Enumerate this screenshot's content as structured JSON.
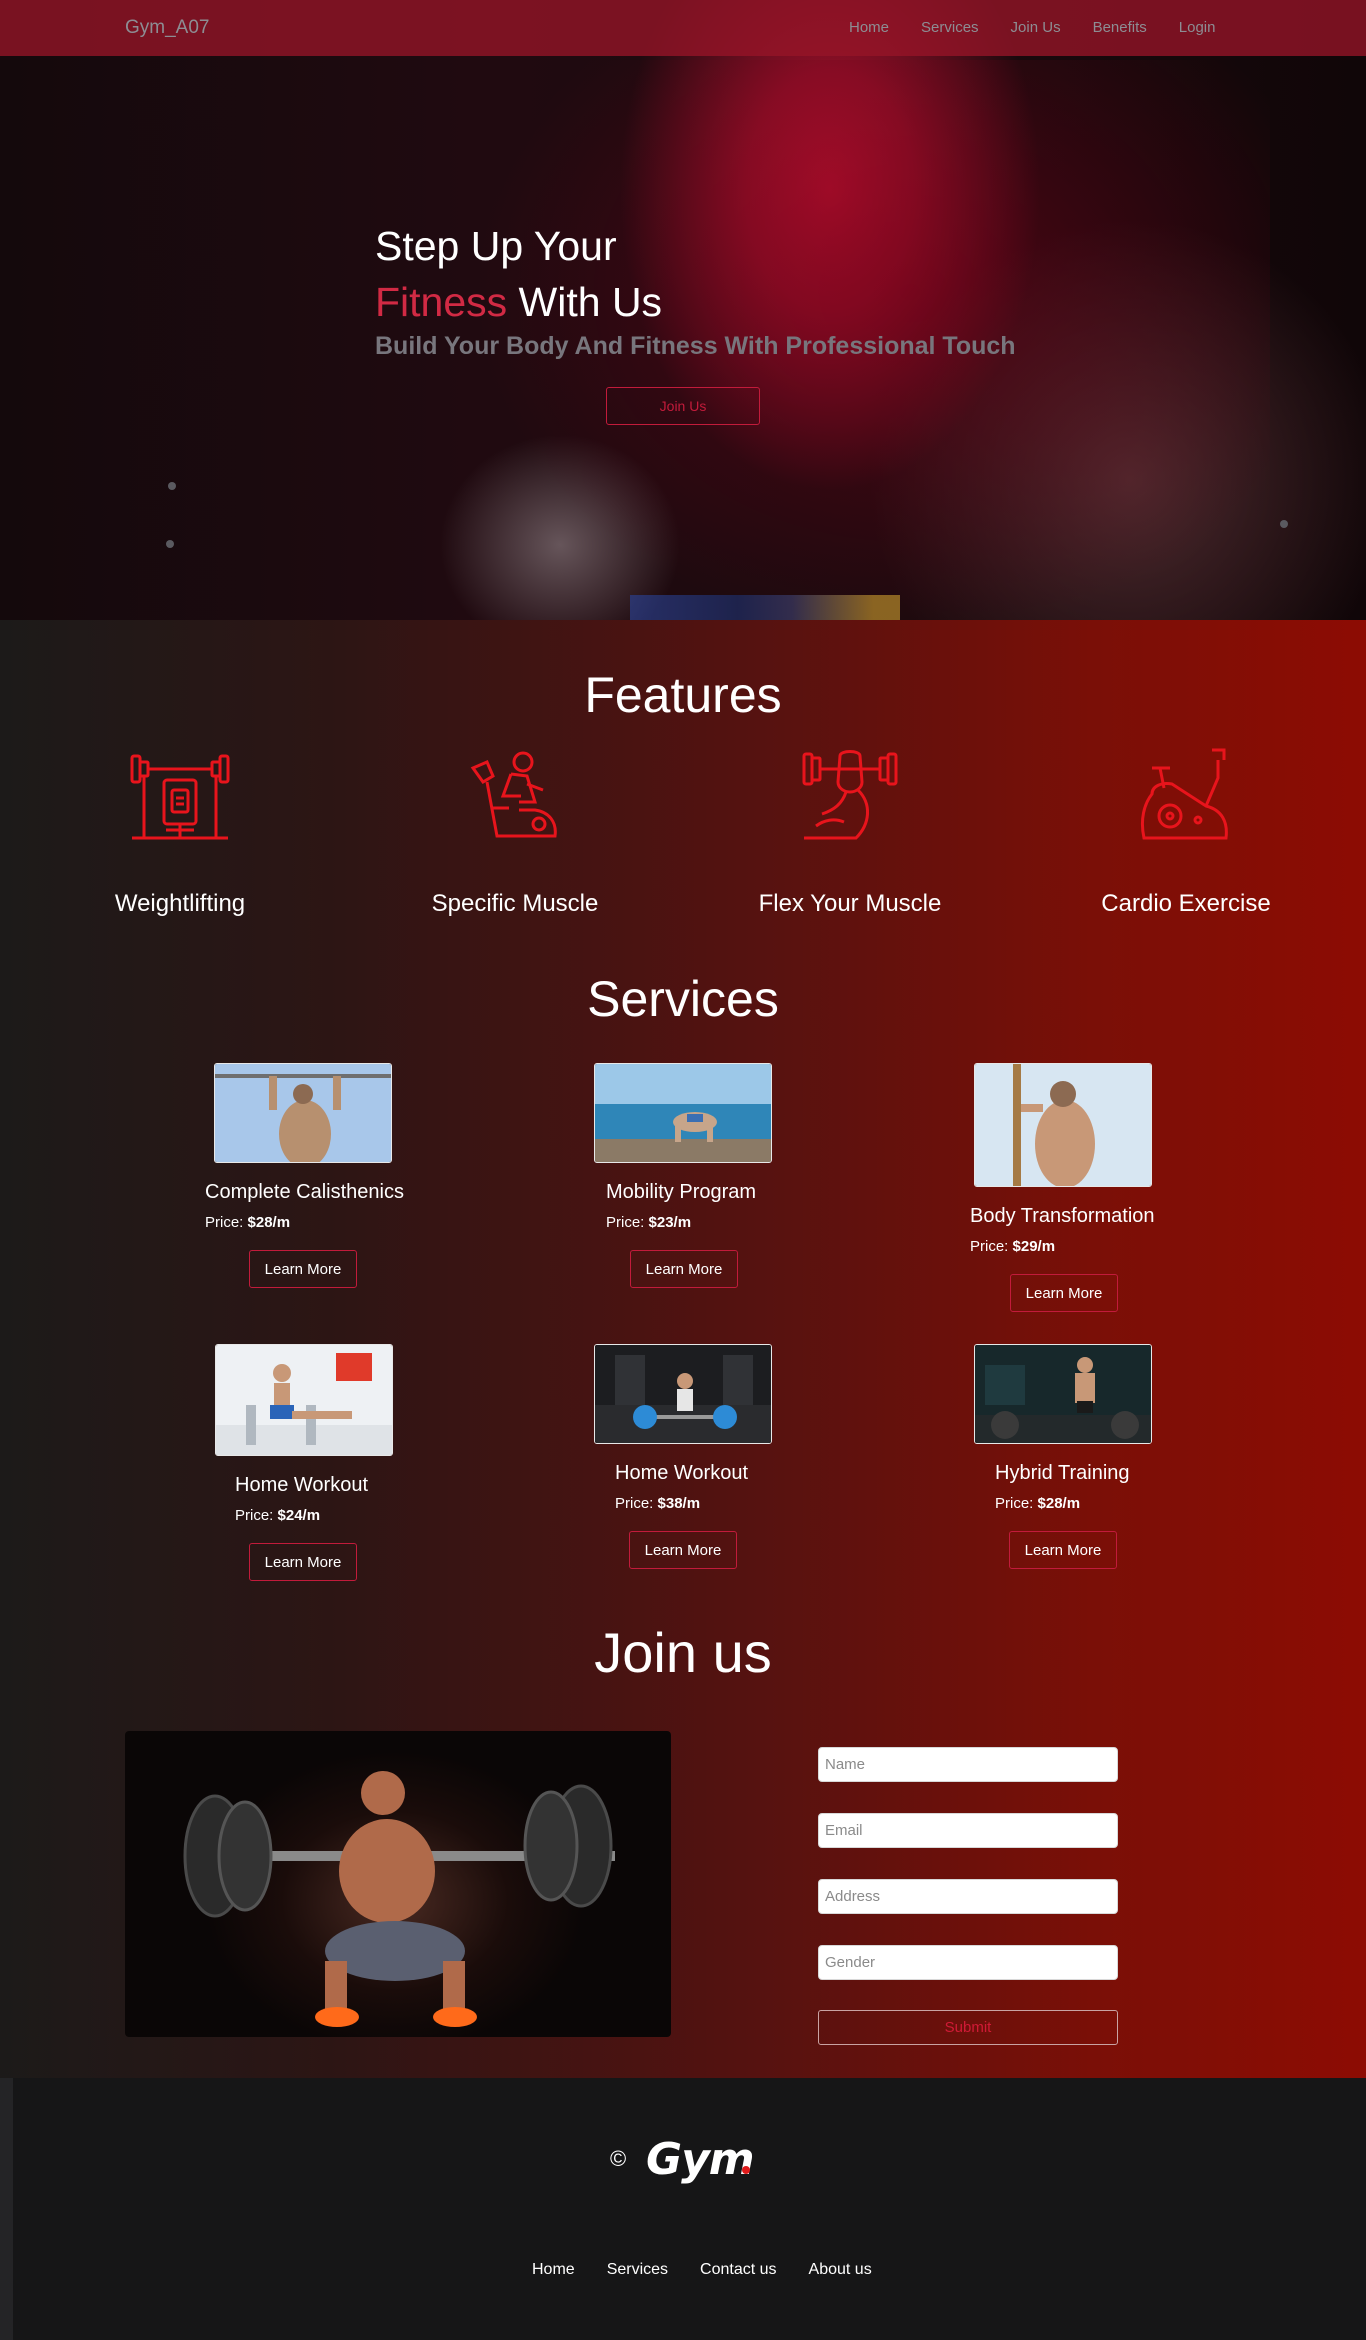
{
  "nav": {
    "brand": "Gym_A07",
    "links": [
      "Home",
      "Services",
      "Join Us",
      "Benefits",
      "Login"
    ]
  },
  "hero": {
    "line1": "Step Up Your",
    "line2_accent": "Fitness",
    "line2_rest": " With Us",
    "subtitle": "Build Your Body And Fitness With Professional Touch",
    "button": "Join Us"
  },
  "features": {
    "title": "Features",
    "items": [
      {
        "label": "Weightlifting",
        "icon": "weight-bench-icon"
      },
      {
        "label": "Specific Muscle",
        "icon": "exercise-bike-rider-icon"
      },
      {
        "label": "Flex Your Muscle",
        "icon": "flexing-arm-icon"
      },
      {
        "label": "Cardio Exercise",
        "icon": "stationary-bike-icon"
      }
    ]
  },
  "services": {
    "title": "Services",
    "price_prefix": "Price:",
    "button": "Learn More",
    "items": [
      {
        "name": "Complete Calisthenics",
        "price": "$28/m"
      },
      {
        "name": "Mobility Program",
        "price": "$23/m"
      },
      {
        "name": "Body Transformation",
        "price": "$29/m"
      },
      {
        "name": "Home Workout",
        "price": "$24/m"
      },
      {
        "name": "Home Workout",
        "price": "$38/m"
      },
      {
        "name": "Hybrid Training",
        "price": "$28/m"
      }
    ]
  },
  "join": {
    "title": "Join us",
    "fields": {
      "name": "Name",
      "email": "Email",
      "address": "Address",
      "gender": "Gender"
    },
    "submit": "Submit"
  },
  "footer": {
    "copyright": "©",
    "logo": "Gym",
    "links": [
      "Home",
      "Services",
      "Contact us",
      "About us"
    ]
  },
  "colors": {
    "accent": "#c21b3b",
    "feature_icon": "#e8141c",
    "footer_bg": "#161617"
  }
}
